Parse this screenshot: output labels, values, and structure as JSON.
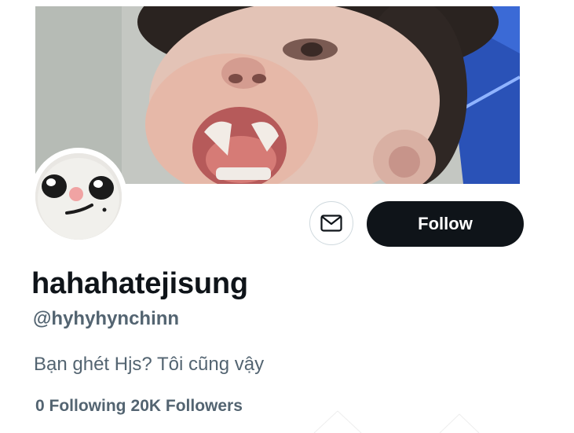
{
  "profile": {
    "display_name": "hahahatejisung",
    "handle": "@hyhyhynchinn",
    "bio": "Bạn ghét Hjs? Tôi cũng vậy",
    "following_count": "0",
    "following_label": "Following",
    "followers_count": "20K",
    "followers_label": "Followers"
  },
  "actions": {
    "follow_label": "Follow",
    "message_icon": "mail-icon"
  },
  "colors": {
    "follow_bg": "#0f1419",
    "follow_text": "#ffffff",
    "primary_text": "#0f1419",
    "secondary_text": "#536471",
    "button_border": "#cfd9de"
  }
}
